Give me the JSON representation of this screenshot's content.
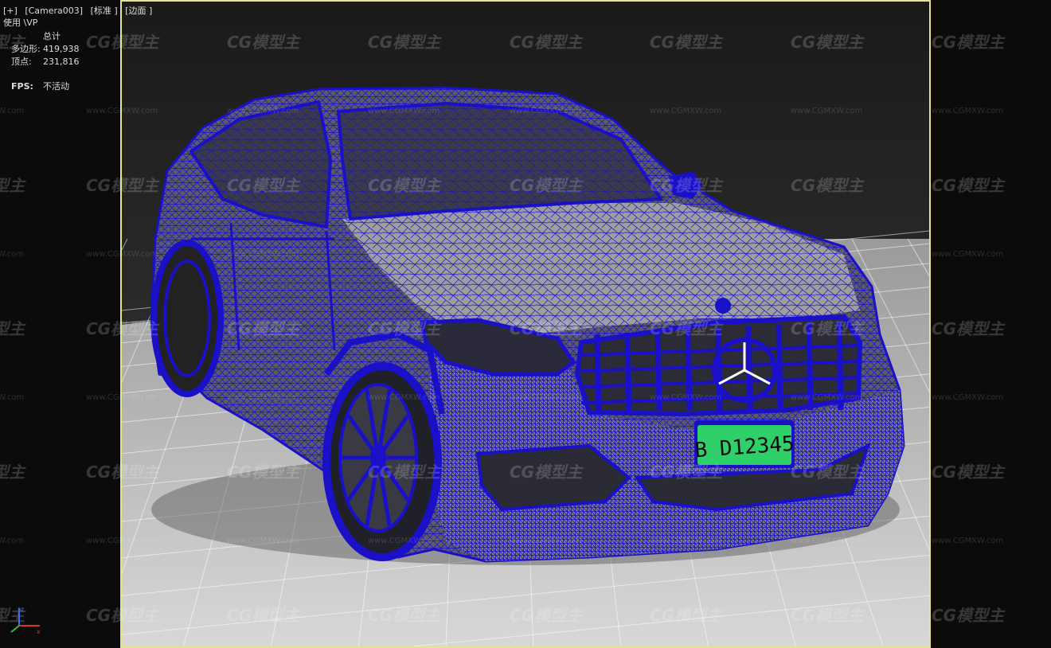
{
  "viewport": {
    "menu_plus": "[+]",
    "camera": "[Camera003]",
    "shading": "[标准 ]",
    "edges": "[边面 ]",
    "mode": "使用 \\VP"
  },
  "stats": {
    "header": "总计",
    "polygons_label": "多边形:",
    "polygons_value": "419,938",
    "vertices_label": "顶点:",
    "vertices_value": "231,816",
    "fps_label": "FPS:",
    "fps_value": "不活动"
  },
  "plate": {
    "text": "B D12345"
  },
  "watermark": {
    "logo": "CG模型主",
    "url": "www.CGMXW.com"
  },
  "colors": {
    "wire": "#1a10c8",
    "frame": "#e6e38a",
    "plate": "#2fd06a"
  }
}
